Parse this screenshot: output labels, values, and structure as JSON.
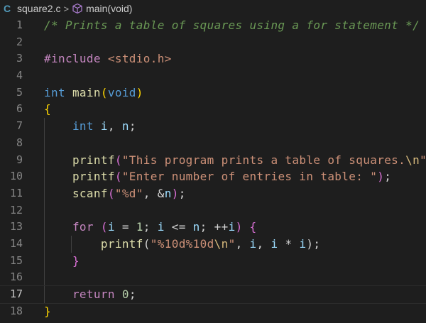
{
  "breadcrumb": {
    "lang_icon": "C",
    "file": "square2.c",
    "separator": ">",
    "symbol_icon": "cube-icon",
    "symbol": "main(void)"
  },
  "editor": {
    "current_line": 17,
    "lines": [
      {
        "n": "1",
        "tokens": [
          {
            "t": "/* Prints a table of squares using a for statement */",
            "c": "comment"
          }
        ]
      },
      {
        "n": "2",
        "tokens": []
      },
      {
        "n": "3",
        "tokens": [
          {
            "t": "#include ",
            "c": "pre"
          },
          {
            "t": "<stdio.h>",
            "c": "inc"
          }
        ]
      },
      {
        "n": "4",
        "tokens": []
      },
      {
        "n": "5",
        "tokens": [
          {
            "t": "int",
            "c": "type"
          },
          {
            "t": " ",
            "c": "punc"
          },
          {
            "t": "main",
            "c": "func"
          },
          {
            "t": "(",
            "c": "b1"
          },
          {
            "t": "void",
            "c": "type"
          },
          {
            "t": ")",
            "c": "b1"
          }
        ]
      },
      {
        "n": "6",
        "tokens": [
          {
            "t": "{",
            "c": "b1"
          }
        ]
      },
      {
        "n": "7",
        "tokens": [
          {
            "t": "    ",
            "c": "punc"
          },
          {
            "t": "int",
            "c": "type"
          },
          {
            "t": " ",
            "c": "punc"
          },
          {
            "t": "i",
            "c": "var"
          },
          {
            "t": ", ",
            "c": "punc"
          },
          {
            "t": "n",
            "c": "var"
          },
          {
            "t": ";",
            "c": "punc"
          }
        ]
      },
      {
        "n": "8",
        "tokens": []
      },
      {
        "n": "9",
        "tokens": [
          {
            "t": "    ",
            "c": "punc"
          },
          {
            "t": "printf",
            "c": "func"
          },
          {
            "t": "(",
            "c": "b2"
          },
          {
            "t": "\"This program prints a table of squares.",
            "c": "str"
          },
          {
            "t": "\\n",
            "c": "esc"
          },
          {
            "t": "\"",
            "c": "str"
          },
          {
            "t": ")",
            "c": "b2"
          },
          {
            "t": ";",
            "c": "punc"
          }
        ]
      },
      {
        "n": "10",
        "tokens": [
          {
            "t": "    ",
            "c": "punc"
          },
          {
            "t": "printf",
            "c": "func"
          },
          {
            "t": "(",
            "c": "b2"
          },
          {
            "t": "\"Enter number of entries in table: \"",
            "c": "str"
          },
          {
            "t": ")",
            "c": "b2"
          },
          {
            "t": ";",
            "c": "punc"
          }
        ]
      },
      {
        "n": "11",
        "tokens": [
          {
            "t": "    ",
            "c": "punc"
          },
          {
            "t": "scanf",
            "c": "func"
          },
          {
            "t": "(",
            "c": "b2"
          },
          {
            "t": "\"%d\"",
            "c": "str"
          },
          {
            "t": ", &",
            "c": "punc"
          },
          {
            "t": "n",
            "c": "var"
          },
          {
            "t": ")",
            "c": "b2"
          },
          {
            "t": ";",
            "c": "punc"
          }
        ]
      },
      {
        "n": "12",
        "tokens": []
      },
      {
        "n": "13",
        "tokens": [
          {
            "t": "    ",
            "c": "punc"
          },
          {
            "t": "for",
            "c": "kw"
          },
          {
            "t": " ",
            "c": "punc"
          },
          {
            "t": "(",
            "c": "b2"
          },
          {
            "t": "i",
            "c": "var"
          },
          {
            "t": " = ",
            "c": "punc"
          },
          {
            "t": "1",
            "c": "num"
          },
          {
            "t": "; ",
            "c": "punc"
          },
          {
            "t": "i",
            "c": "var"
          },
          {
            "t": " <= ",
            "c": "punc"
          },
          {
            "t": "n",
            "c": "var"
          },
          {
            "t": "; ++",
            "c": "punc"
          },
          {
            "t": "i",
            "c": "var"
          },
          {
            "t": ")",
            "c": "b2"
          },
          {
            "t": " ",
            "c": "punc"
          },
          {
            "t": "{",
            "c": "b2"
          }
        ]
      },
      {
        "n": "14",
        "tokens": [
          {
            "t": "        ",
            "c": "punc"
          },
          {
            "t": "printf",
            "c": "func"
          },
          {
            "t": "(",
            "c": "b3"
          },
          {
            "t": "\"%10d%10d",
            "c": "str"
          },
          {
            "t": "\\n",
            "c": "esc"
          },
          {
            "t": "\"",
            "c": "str"
          },
          {
            "t": ", ",
            "c": "punc"
          },
          {
            "t": "i",
            "c": "var"
          },
          {
            "t": ", ",
            "c": "punc"
          },
          {
            "t": "i",
            "c": "var"
          },
          {
            "t": " * ",
            "c": "punc"
          },
          {
            "t": "i",
            "c": "var"
          },
          {
            "t": ")",
            "c": "b3"
          },
          {
            "t": ";",
            "c": "punc"
          }
        ]
      },
      {
        "n": "15",
        "tokens": [
          {
            "t": "    ",
            "c": "punc"
          },
          {
            "t": "}",
            "c": "b2"
          }
        ]
      },
      {
        "n": "16",
        "tokens": []
      },
      {
        "n": "17",
        "tokens": [
          {
            "t": "    ",
            "c": "punc"
          },
          {
            "t": "return",
            "c": "kw"
          },
          {
            "t": " ",
            "c": "punc"
          },
          {
            "t": "0",
            "c": "num"
          },
          {
            "t": ";",
            "c": "punc"
          }
        ]
      },
      {
        "n": "18",
        "tokens": [
          {
            "t": "}",
            "c": "b1"
          }
        ]
      }
    ]
  }
}
